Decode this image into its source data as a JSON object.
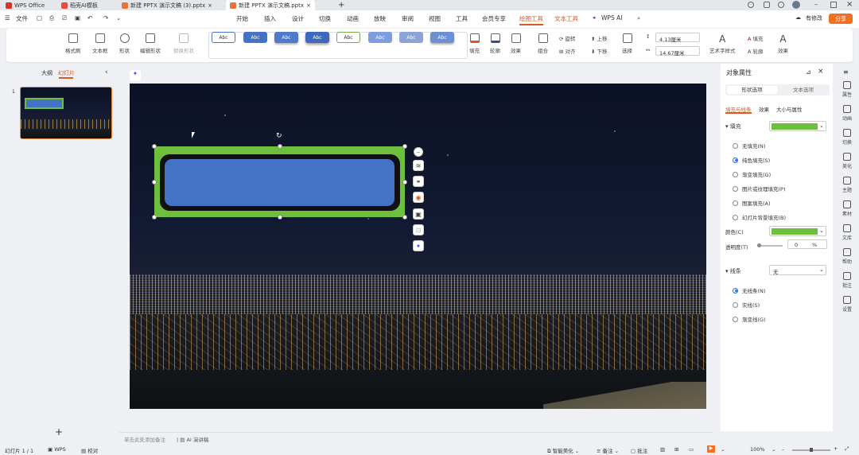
{
  "titlebar": {
    "tabs": [
      "WPS Office",
      "稻壳AI模板",
      "新建 PPTX 演示文稿 (3).pptx",
      "新建 PPTX 演示文稿.pptx"
    ],
    "new_tab": "+"
  },
  "menu": {
    "file": "文件",
    "items": [
      "开始",
      "插入",
      "设计",
      "切换",
      "动画",
      "放映",
      "审阅",
      "视图",
      "工具",
      "会员专享",
      "绘图工具",
      "文本工具",
      "WPS AI"
    ],
    "modify": "有修改",
    "share": "分享"
  },
  "ribbon": {
    "format_painter": "格式刷",
    "textbox": "文本框",
    "shape": "形状",
    "edit_shape": "编辑形状",
    "replace_shape": "替换形状",
    "style_label": "Abc",
    "fill": "填充",
    "outline": "轮廓",
    "effect": "效果",
    "group": "组合",
    "rotate": "旋转",
    "align": "对齐",
    "up": "上移",
    "down": "下移",
    "select": "选择",
    "height": "4.13厘米",
    "width": "14.67厘米",
    "art_text": "艺术字样式",
    "text_fill": "填充",
    "text_outline": "轮廓",
    "text_effect": "效果"
  },
  "left": {
    "outline_tab": "大纲",
    "slides_tab": "幻灯片",
    "slide_num": "1",
    "add": "+"
  },
  "notes": {
    "placeholder": "单击此处添加备注",
    "ai": "AI 演讲稿"
  },
  "panel": {
    "title": "对象属性",
    "tab_shape": "形状选项",
    "tab_text": "文本选项",
    "sub_fill": "填充与线条",
    "sub_effect": "效果",
    "sub_size": "大小与属性",
    "fill_label": "填充",
    "fill_options": [
      "无填充(N)",
      "纯色填充(S)",
      "渐变填充(G)",
      "图片或纹理填充(P)",
      "图案填充(A)",
      "幻灯片背景填充(B)"
    ],
    "fill_selected": 1,
    "color_label": "颜色(C)",
    "fill_color": "#6fbf3f",
    "transparency_label": "透明度(T)",
    "transparency": "0",
    "transparency_unit": "%",
    "line_label": "线条",
    "line_value": "无",
    "line_options": [
      "无线条(N)",
      "实线(S)",
      "渐变线(G)"
    ],
    "line_selected": 0
  },
  "rail": [
    "属性",
    "动画",
    "切换",
    "美化",
    "主题",
    "素材",
    "文库",
    "帮助",
    "批注",
    "设置"
  ],
  "status": {
    "slide": "幻灯片 1 / 1",
    "theme": "WPS",
    "proof": "校对",
    "beautify": "智能美化",
    "notes": "备注",
    "comment": "批注",
    "zoom": "100%"
  },
  "colors": {
    "accent": "#d85a22",
    "shape_border": "#6fbf3f",
    "shape_fill": "#4472c4"
  }
}
